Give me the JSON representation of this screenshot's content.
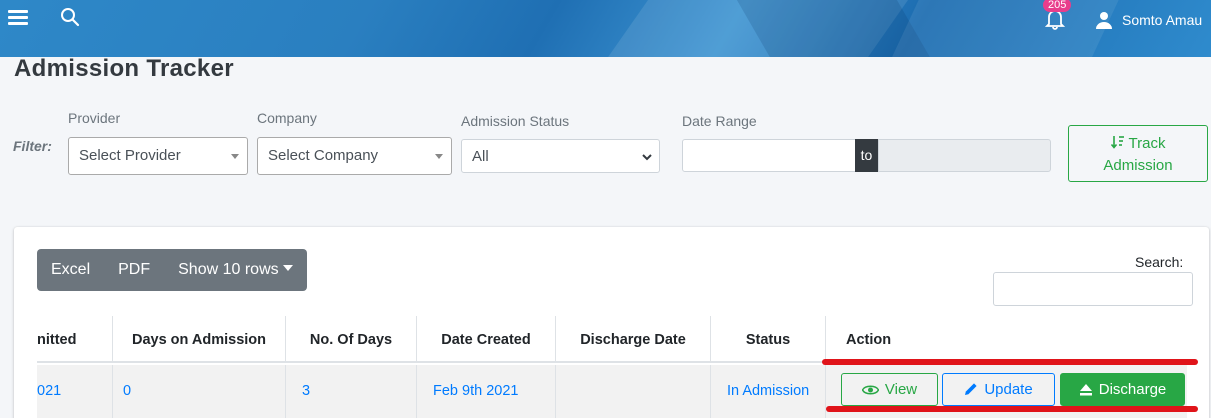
{
  "topbar": {
    "notification_count": "205",
    "user_name": "Somto Amau"
  },
  "page": {
    "title": "Admission Tracker"
  },
  "filter": {
    "label": "Filter:",
    "provider": {
      "label": "Provider",
      "value": "Select Provider"
    },
    "company": {
      "label": "Company",
      "value": "Select Company"
    },
    "status": {
      "label": "Admission Status",
      "value": "All"
    },
    "date_range": {
      "label": "Date Range",
      "to": "to",
      "start": "",
      "end": ""
    },
    "track_button": {
      "line1": "Track",
      "line2": "Admission"
    }
  },
  "toolbar": {
    "excel": "Excel",
    "pdf": "PDF",
    "rows": "Show 10 rows"
  },
  "search": {
    "label": "Search:",
    "value": ""
  },
  "table": {
    "headers": {
      "admitted": "nitted",
      "days_on_admission": "Days on Admission",
      "no_of_days": "No. Of Days",
      "date_created": "Date Created",
      "discharge_date": "Discharge Date",
      "status": "Status",
      "action": "Action"
    },
    "rows": [
      {
        "admitted": "021",
        "days_on_admission": "0",
        "no_of_days": "3",
        "date_created": "Feb 9th 2021",
        "discharge_date": "",
        "status": "In Admission",
        "actions": {
          "view": "View",
          "update": "Update",
          "discharge": "Discharge"
        }
      }
    ]
  },
  "colors": {
    "accent_green": "#28a745",
    "accent_blue": "#007bff",
    "annotation_red": "#e0141a"
  }
}
